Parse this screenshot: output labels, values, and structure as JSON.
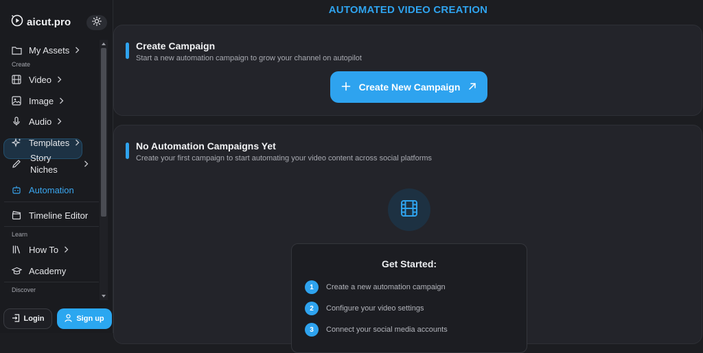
{
  "brand": {
    "name": "aicut.pro"
  },
  "sidebar": {
    "sections": {
      "create": "Create",
      "learn": "Learn",
      "discover": "Discover"
    },
    "items": [
      {
        "label": "My Assets",
        "icon": "folder-icon"
      },
      {
        "label": "Video",
        "icon": "film-icon"
      },
      {
        "label": "Image",
        "icon": "image-icon"
      },
      {
        "label": "Audio",
        "icon": "microphone-icon"
      },
      {
        "label": "Templates",
        "icon": "sparkles-icon"
      },
      {
        "label": "Story\nNiches",
        "icon": "pencil-icon"
      },
      {
        "label": "Automation",
        "icon": "robot-icon"
      },
      {
        "label": "Timeline Editor",
        "icon": "clapperboard-icon"
      },
      {
        "label": "How To",
        "icon": "books-icon"
      },
      {
        "label": "Academy",
        "icon": "graduation-cap-icon"
      }
    ],
    "active": "Automation"
  },
  "auth": {
    "login": "Login",
    "signup": "Sign up"
  },
  "main": {
    "title": "AUTOMATED VIDEO CREATION",
    "create_card": {
      "title": "Create Campaign",
      "subtitle": "Start a new automation campaign to grow your channel on autopilot",
      "button": "Create New Campaign"
    },
    "empty_card": {
      "title": "No Automation Campaigns Yet",
      "subtitle": "Create your first campaign to start automating your video content across social platforms",
      "get_started": {
        "title": "Get Started:",
        "steps": [
          {
            "num": "1",
            "text": "Create a new automation campaign"
          },
          {
            "num": "2",
            "text": "Configure your video settings"
          },
          {
            "num": "3",
            "text": "Connect your social media accounts"
          }
        ]
      }
    }
  },
  "colors": {
    "accent": "#2fa3ee",
    "background": "#1c1d21",
    "card": "#23242a"
  }
}
